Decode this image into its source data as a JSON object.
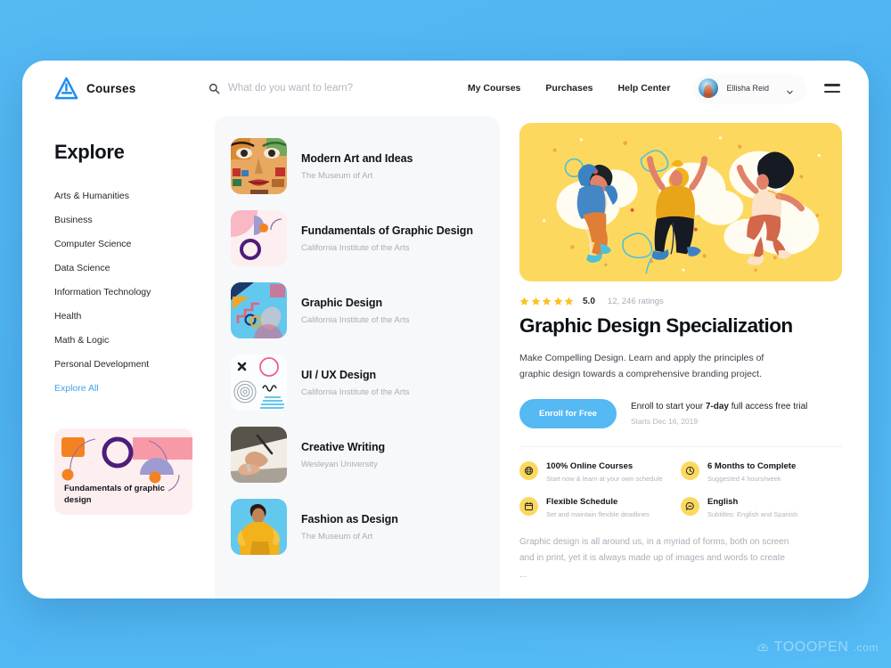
{
  "window": {
    "background_color": "#55b9f3",
    "card_color": "#ffffff"
  },
  "header": {
    "brand_name": "Courses",
    "logo_icon": "triangle-a-logo",
    "search": {
      "icon": "search-icon",
      "placeholder": "What do you want to learn?",
      "value": ""
    },
    "nav_links": [
      {
        "label": "My Courses"
      },
      {
        "label": "Purchases"
      },
      {
        "label": "Help Center"
      }
    ],
    "user": {
      "name": "Ellisha Reid",
      "avatar_icon": "user-avatar",
      "chevron_icon": "chevron-down-icon"
    },
    "menu_icon": "hamburger-menu-icon"
  },
  "sidebar": {
    "title": "Explore",
    "categories": [
      {
        "label": "Arts & Humanities",
        "is_link": false
      },
      {
        "label": "Business",
        "is_link": false
      },
      {
        "label": "Computer Science",
        "is_link": false
      },
      {
        "label": "Data Science",
        "is_link": false
      },
      {
        "label": "Information Technology",
        "is_link": false
      },
      {
        "label": "Health",
        "is_link": false
      },
      {
        "label": "Math & Logic",
        "is_link": false
      },
      {
        "label": "Personal Development",
        "is_link": false
      },
      {
        "label": "Explore All",
        "is_link": true
      }
    ],
    "promo": {
      "label": "Fundamentals of graphic design",
      "background_color": "#fdeef0",
      "accent_colors": [
        "#f58220",
        "#4c1d7a",
        "#f4a0b0",
        "#9d9bd0"
      ]
    }
  },
  "course_list": {
    "courses": [
      {
        "title": "Modern Art and Ideas",
        "provider": "The Museum of Art",
        "thumb": "portrait-painting"
      },
      {
        "title": "Fundamentals of Graphic Design",
        "provider": "California Institute of the Arts",
        "thumb": "pink-abstract-shapes"
      },
      {
        "title": "Graphic Design",
        "provider": "California Institute of the Arts",
        "thumb": "blue-memphis-pattern"
      },
      {
        "title": "UI / UX Design",
        "provider": "California Institute of the Arts",
        "thumb": "white-wireframe-shapes"
      },
      {
        "title": "Creative Writing",
        "provider": "Wesleyan University",
        "thumb": "hand-writing-photo"
      },
      {
        "title": "Fashion as Design",
        "provider": "The Museum of Art",
        "thumb": "yellow-fashion-photo"
      }
    ]
  },
  "detail": {
    "hero": {
      "icon": "jumping-people-illustration",
      "background_color": "#fcd95e"
    },
    "rating": {
      "stars": 5,
      "value": "5.0",
      "count": "12, 246 ratings",
      "star_color": "#fcc221"
    },
    "title": "Graphic Design Specialization",
    "description": "Make Compelling Design. Learn and apply the principles of graphic design towards a comprehensive branding project.",
    "enroll": {
      "button_label": "Enroll for Free",
      "button_color": "#55b9f3",
      "note_prefix": "Enroll to start your ",
      "note_bold": "7-day",
      "note_suffix": " full access free trial",
      "starts": "Starts Dec 16, 2019"
    },
    "features": [
      {
        "title": "100% Online Courses",
        "subtitle": "Start now & learn at your own schedule",
        "icon": "globe-icon"
      },
      {
        "title": "6 Months to Complete",
        "subtitle": "Suggested 4 hours/week",
        "icon": "clock-icon"
      },
      {
        "title": "Flexible Schedule",
        "subtitle": "Set and maintain flexible deadlines",
        "icon": "calendar-icon"
      },
      {
        "title": "English",
        "subtitle": "Subtitles: English and Spanish",
        "icon": "chat-bubble-icon"
      }
    ],
    "long_description": "Graphic design is all around us, in a myriad of forms, both on screen and in print, yet it is always made up of images and words to create ..."
  },
  "watermark": {
    "text": "TOOOPEN",
    "suffix": ".com",
    "icon": "cloud-icon"
  }
}
